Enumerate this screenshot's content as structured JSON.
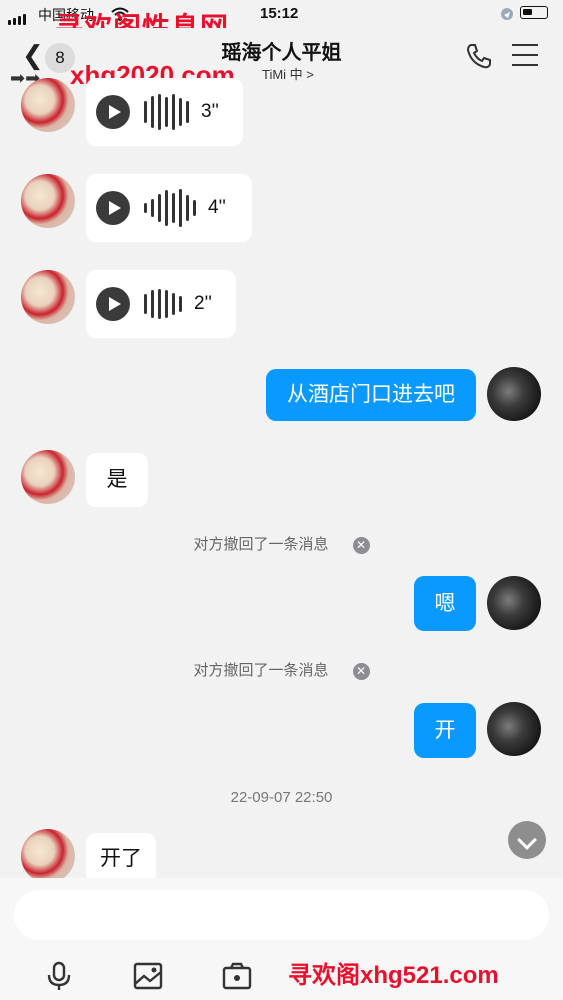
{
  "status": {
    "carrier": "中国移动",
    "time": "15:12"
  },
  "watermarks": {
    "site_name": "寻欢阁性息网",
    "url_top": "xhg2020.com",
    "url_bottom": "寻欢阁xhg521.com"
  },
  "header": {
    "back_count": "8",
    "title": "瑶海个人平姐",
    "subtitle": "TiMi 中 >"
  },
  "messages": [
    {
      "side": "left",
      "type": "voice",
      "duration": "3''"
    },
    {
      "side": "left",
      "type": "voice",
      "duration": "4''"
    },
    {
      "side": "left",
      "type": "voice",
      "duration": "2''"
    },
    {
      "side": "right",
      "type": "text",
      "text": "从酒店门口进去吧"
    },
    {
      "side": "left",
      "type": "text",
      "text": "是"
    },
    {
      "type": "system",
      "text": "对方撤回了一条消息"
    },
    {
      "side": "right",
      "type": "text",
      "text": "嗯"
    },
    {
      "type": "system",
      "text": "对方撤回了一条消息"
    },
    {
      "side": "right",
      "type": "text",
      "text": "开"
    },
    {
      "type": "timestamp",
      "text": "22-09-07 22:50"
    },
    {
      "side": "left",
      "type": "text",
      "text": "开了"
    }
  ],
  "composer": {
    "input_value": ""
  },
  "colors": {
    "accent_blue": "#0a99ff",
    "watermark_red": "#e8112d",
    "background": "#f2f2f2"
  },
  "icons": [
    "back-arrow-icon",
    "phone-icon",
    "menu-icon",
    "play-icon",
    "close-icon",
    "chevron-down-icon",
    "microphone-icon",
    "image-icon",
    "camera-icon"
  ]
}
